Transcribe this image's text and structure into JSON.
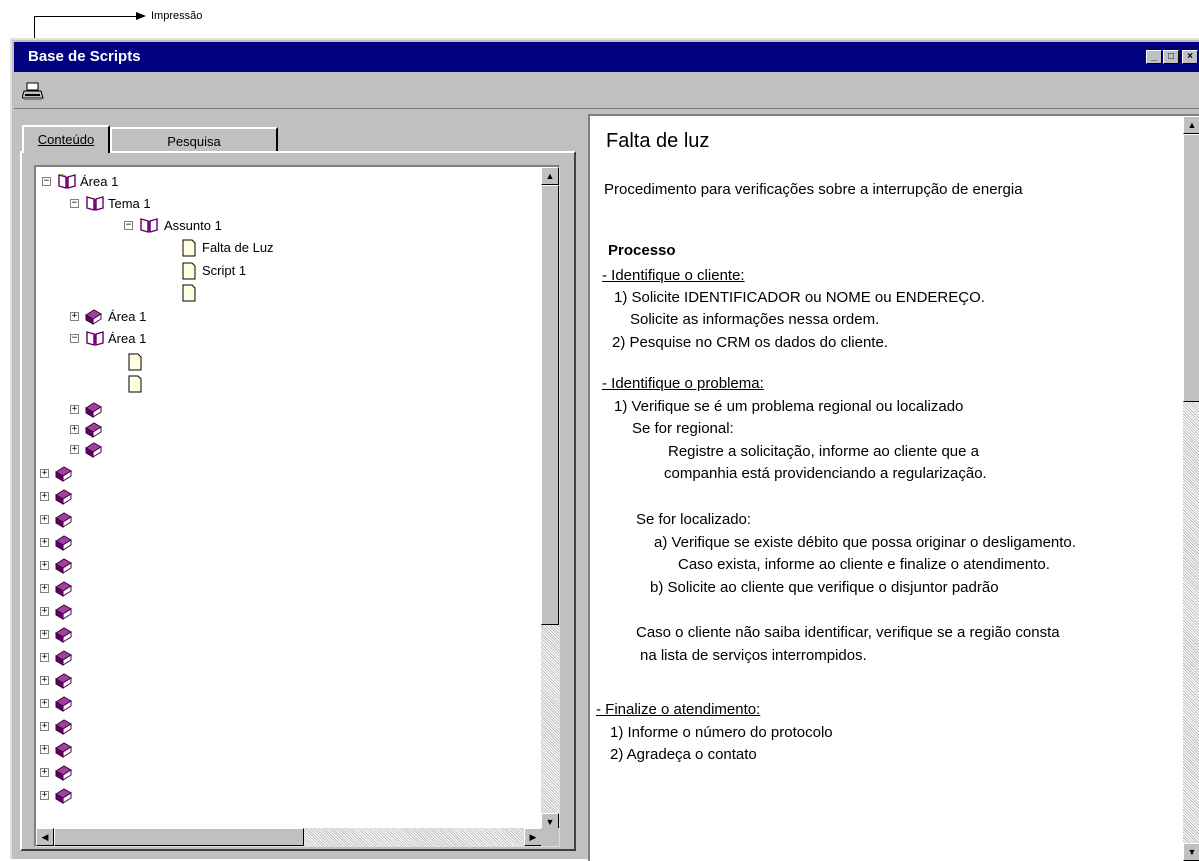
{
  "annotation": {
    "label": "Impressão"
  },
  "window": {
    "title": "Base de Scripts",
    "controls": {
      "minimize": "_",
      "maximize": "□",
      "close": "×"
    }
  },
  "toolbar": {
    "print_icon": "printer-icon"
  },
  "tabs": [
    {
      "label": "Conteúdo",
      "active": true
    },
    {
      "label": "Pesquisa",
      "active": false
    }
  ],
  "tree": {
    "nodes": [
      {
        "label": "Área 1",
        "icon": "book-open",
        "expander": "−"
      },
      {
        "label": "Tema 1",
        "icon": "book-open",
        "expander": "−"
      },
      {
        "label": "Assunto 1",
        "icon": "book-open",
        "expander": "−"
      },
      {
        "label": "Falta de Luz",
        "icon": "page"
      },
      {
        "label": "Script 1",
        "icon": "page"
      },
      {
        "label": "",
        "icon": "page"
      },
      {
        "label": "Área 1",
        "icon": "book-closed",
        "expander": "+"
      },
      {
        "label": "Área 1",
        "icon": "book-open",
        "expander": "−"
      },
      {
        "label": "",
        "icon": "page"
      },
      {
        "label": "",
        "icon": "page"
      }
    ]
  },
  "document": {
    "title": "Falta de luz",
    "subtitle": "Procedimento para verificações sobre a interrupção de energia",
    "section": "Processo",
    "lines": [
      "- Identifique o cliente:",
      "1) Solicite IDENTIFICADOR ou NOME ou ENDEREÇO.",
      "Solicite as informações nessa ordem.",
      "2) Pesquise no CRM os dados do cliente.",
      "- Identifique o problema:",
      "1) Verifique se é um problema regional ou localizado",
      "Se for regional:",
      "Registre a solicitação, informe ao cliente que a",
      "companhia está providenciando a regularização.",
      "Se for localizado:",
      "a) Verifique se existe débito que possa originar o desligamento.",
      "Caso exista, informe ao cliente e finalize o atendimento.",
      "b) Solicite ao cliente que verifique o disjuntor padrão",
      "Caso o cliente não saiba identificar, verifique se a região consta",
      "na lista de serviços interrompidos.",
      "- Finalize o atendimento:",
      "1) Informe o número do protocolo",
      "2) Agradeça o contato"
    ]
  },
  "colors": {
    "titlebar": "#000080",
    "chrome": "#c0c0c0",
    "book": "#800080"
  }
}
